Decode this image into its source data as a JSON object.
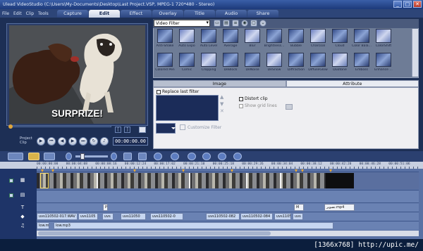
{
  "window": {
    "title": "Ulead VideoStudio (C:\\Users\\My-Documents\\Desktop\\Last Project.VSP, MPEG-1 720*480 - Stereo)",
    "buttons": [
      "_",
      "□",
      "✕"
    ]
  },
  "menu": [
    "File",
    "Edit",
    "Clip",
    "Tools"
  ],
  "steps": [
    {
      "label": "Capture",
      "active": false
    },
    {
      "label": "Edit",
      "active": true
    },
    {
      "label": "Effect",
      "active": false
    },
    {
      "label": "Overlay",
      "active": false
    },
    {
      "label": "Title",
      "active": false
    },
    {
      "label": "Audio",
      "active": false
    },
    {
      "label": "Share",
      "active": false
    }
  ],
  "preview": {
    "caption": "SURPRIZE!",
    "mode_label": "Project\nClip",
    "timecode": "00:00:00.00"
  },
  "library": {
    "selected": "Video Filter",
    "filters": [
      "Anti-Shake",
      "Auto Expo",
      "Auto Level",
      "Average",
      "Blur",
      "Brightness...",
      "Bubble",
      "Charcoal",
      "Cloud",
      "Color Bala...",
      "ColorShift",
      "Colored Pen",
      "Comic",
      "Cropping",
      "DeBlock",
      "DeNoise",
      "DeSnow",
      "Diffraction",
      "DiffuseGlow",
      "Duotone",
      "Emboss",
      "Enhance ..."
    ]
  },
  "options": {
    "tabs": [
      "Image",
      "Attribute"
    ],
    "active_tab": "Attribute",
    "replace_last_filter": "Replace last filter",
    "distort_clip": "Distort clip",
    "show_grid_lines": "Show grid lines",
    "customize_filter": "Customize Filter"
  },
  "timeline": {
    "ruler": [
      "00:00:00:00",
      "00:00:04:08",
      "00:00:08:16",
      "00:00:12:24",
      "00:00:17:02",
      "00:00:21:10",
      "00:00:25:18",
      "00:00:29:26",
      "00:00:34:04",
      "00:00:38:12",
      "00:00:42:20",
      "00:00:46:28",
      "00:00:51:06"
    ],
    "title_clips": [
      "P",
      "M",
      "تصوير.mp4"
    ],
    "voice_clips": [
      "uvs110502-017.WAV",
      "uvs1105",
      "uvs",
      "uvs11050",
      "uvs110502-0",
      "uvs110502-082",
      "uvs110502-084",
      "uvs1105",
      "uvs"
    ],
    "music_clips": [
      "low.mp",
      "low.mp3"
    ]
  },
  "footer": "[1366x768] http://upic.me/"
}
